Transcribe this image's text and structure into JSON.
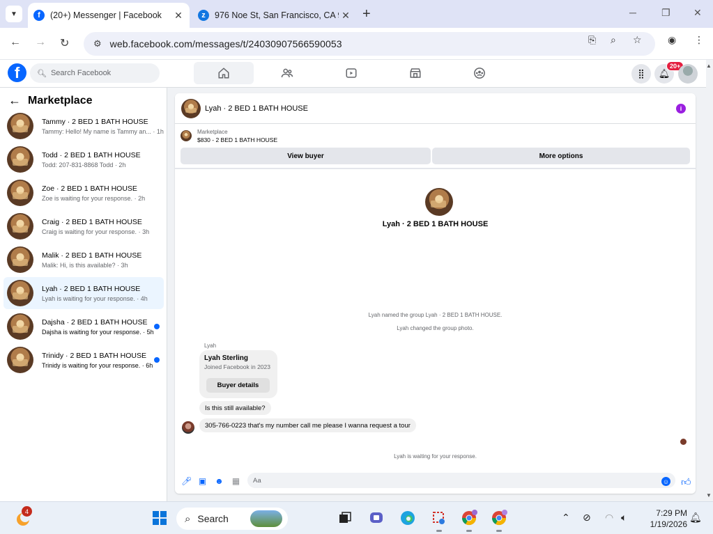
{
  "browser": {
    "tabs": [
      {
        "title": "(20+) Messenger | Facebook",
        "active": true
      },
      {
        "title": "976 Noe St, San Francisco, CA 9",
        "active": false
      }
    ],
    "url": "web.facebook.com/messages/t/24030907566590053"
  },
  "facebook": {
    "search_placeholder": "Search Facebook",
    "nav": [
      "home-icon",
      "friends-icon",
      "video-icon",
      "marketplace-icon",
      "groups-icon"
    ],
    "notification_badge": "20+"
  },
  "sidebar": {
    "title": "Marketplace",
    "conversations": [
      {
        "name": "Tammy · 2 BED 1 BATH HOUSE",
        "snippet": "Tammy: Hello! My name is Tammy an...",
        "time": "· 1h",
        "selected": false,
        "unread": false
      },
      {
        "name": "Todd · 2 BED 1 BATH HOUSE",
        "snippet": "Todd: 207-831-8868 Todd",
        "time": "· 2h",
        "selected": false,
        "unread": false
      },
      {
        "name": "Zoe · 2 BED 1 BATH HOUSE",
        "snippet": "Zoe is waiting for your response.",
        "time": "· 2h",
        "selected": false,
        "unread": false
      },
      {
        "name": "Craig · 2 BED 1 BATH HOUSE",
        "snippet": "Craig is waiting for your response.",
        "time": "· 3h",
        "selected": false,
        "unread": false
      },
      {
        "name": "Malik · 2 BED 1 BATH HOUSE",
        "snippet": "Malik: Hi, is this available?",
        "time": "· 3h",
        "selected": false,
        "unread": false
      },
      {
        "name": "Lyah · 2 BED 1 BATH HOUSE",
        "snippet": "Lyah is waiting for your response.",
        "time": "· 4h",
        "selected": true,
        "unread": false
      },
      {
        "name": "Dajsha · 2 BED 1 BATH HOUSE",
        "snippet": "Dajsha is waiting for your response.",
        "time": "· 5h",
        "selected": false,
        "unread": true
      },
      {
        "name": "Trinidy · 2 BED 1 BATH HOUSE",
        "snippet": "Trinidy is waiting for your response.",
        "time": "· 6h",
        "selected": false,
        "unread": true
      }
    ]
  },
  "chat": {
    "title": "Lyah · 2 BED 1 BATH HOUSE",
    "marketplace_label": "Marketplace",
    "listing": "$830 - 2 BED 1 BATH HOUSE",
    "view_buyer_label": "View buyer",
    "more_options_label": "More options",
    "center_name": "Lyah · 2 BED 1 BATH HOUSE",
    "system_messages": [
      "Lyah named the group Lyah · 2 BED 1 BATH HOUSE.",
      "Lyah changed the group photo."
    ],
    "sender_label": "Lyah",
    "card": {
      "name": "Lyah Sterling",
      "joined": "Joined Facebook in 2023",
      "button_label": "Buyer details"
    },
    "messages": [
      "Is this still available?",
      "305-766-0223 that's my number call me please I wanna request a tour"
    ],
    "waiting_text": "Lyah is waiting for your response.",
    "composer_placeholder": "Aa"
  },
  "taskbar": {
    "search_label": "Search",
    "widget_badge": "4",
    "time": "7:29 PM",
    "date": "1/19/2026"
  },
  "colors": {
    "facebook_blue": "#0866ff",
    "selected_row": "#ebf5ff",
    "info_purple": "#9a1fe0",
    "badge_red": "#e41e3f"
  }
}
